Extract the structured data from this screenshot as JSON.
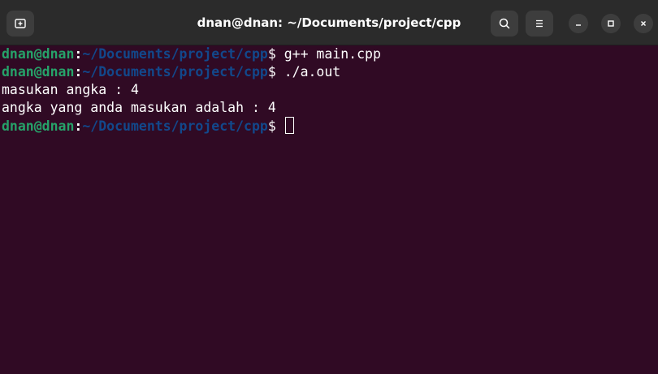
{
  "window": {
    "title": "dnan@dnan: ~/Documents/project/cpp"
  },
  "titlebar": {
    "new_tab_icon": "new-tab-icon",
    "search_icon": "search-icon",
    "menu_icon": "hamburger-menu-icon",
    "minimize_icon": "minimize-icon",
    "maximize_icon": "maximize-icon",
    "close_icon": "close-icon"
  },
  "terminal": {
    "lines": [
      {
        "user": "dnan@dnan",
        "colon": ":",
        "path": "~/Documents/project/cpp",
        "dollar": "$",
        "command": " g++ main.cpp"
      },
      {
        "user": "dnan@dnan",
        "colon": ":",
        "path": "~/Documents/project/cpp",
        "dollar": "$",
        "command": " ./a.out"
      },
      {
        "output": "masukan angka : 4"
      },
      {
        "output": "angka yang anda masukan adalah : 4"
      },
      {
        "user": "dnan@dnan",
        "colon": ":",
        "path": "~/Documents/project/cpp",
        "dollar": "$",
        "command": " "
      }
    ]
  },
  "colors": {
    "background": "#300a24",
    "titlebar": "#2b2b2b",
    "prompt_user": "#26a269",
    "prompt_path": "#12488b",
    "text": "#ffffff"
  }
}
